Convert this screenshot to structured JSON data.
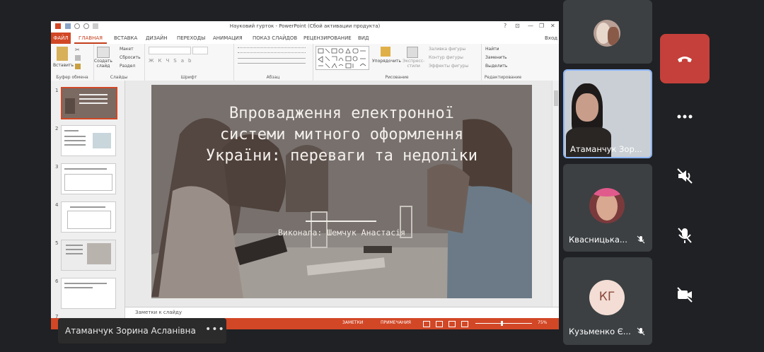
{
  "ppt": {
    "window_title": "Науковий гурток - PowerPoint (Сбой активации продукта)",
    "window_controls": [
      "?",
      "⊡",
      "—",
      "❐",
      "✕"
    ],
    "signin": "Вход",
    "tabs": [
      "ФАЙЛ",
      "ГЛАВНАЯ",
      "ВСТАВКА",
      "ДИЗАЙН",
      "ПЕРЕХОДЫ",
      "АНИМАЦИЯ",
      "ПОКАЗ СЛАЙДОВ",
      "РЕЦЕНЗИРОВАНИЕ",
      "ВИД"
    ],
    "ribbon": {
      "paste": "Вставить",
      "create_slide": "Создать\nслайд",
      "layout": "Макет",
      "reset": "Сбросить",
      "section": "Раздел",
      "arrange": "Упорядочить",
      "quick_styles": "Экспресс-\nстили",
      "fill": "Заливка фигуры",
      "outline": "Контур фигуры",
      "effects": "Эффекты фигуры",
      "find": "Найти",
      "replace": "Заменить",
      "select": "Выделить",
      "groups": [
        "Буфер обмена",
        "Слайды",
        "Шрифт",
        "Абзац",
        "Рисование",
        "Редактирование"
      ]
    },
    "slide_numbers": [
      "1",
      "2",
      "3",
      "4",
      "5",
      "6",
      "7"
    ],
    "slide": {
      "title": "Впровадження електронної системи митного оформлення України: переваги та недоліки",
      "subtitle": "Виконала: Шемчук Анастасія"
    },
    "notes_placeholder": "Заметки к слайду",
    "status": {
      "notes": "ЗАМЕТКИ",
      "comments": "ПРИМЕЧАНИЯ",
      "zoom": "75%"
    }
  },
  "presenter": {
    "name": "Атаманчук Зорина Асланівна",
    "more": "•••"
  },
  "participants": [
    {
      "name": "",
      "kind": "avatar-photo"
    },
    {
      "name": "Атаманчук Зор...",
      "kind": "video",
      "speaking": true
    },
    {
      "name": "Квасницька...",
      "kind": "avatar-photo",
      "muted": true
    },
    {
      "name": "Кузьменко Є...",
      "initials": "КГ",
      "kind": "initials",
      "muted": true
    }
  ],
  "controls": {
    "leave_color": "#c5403a"
  }
}
